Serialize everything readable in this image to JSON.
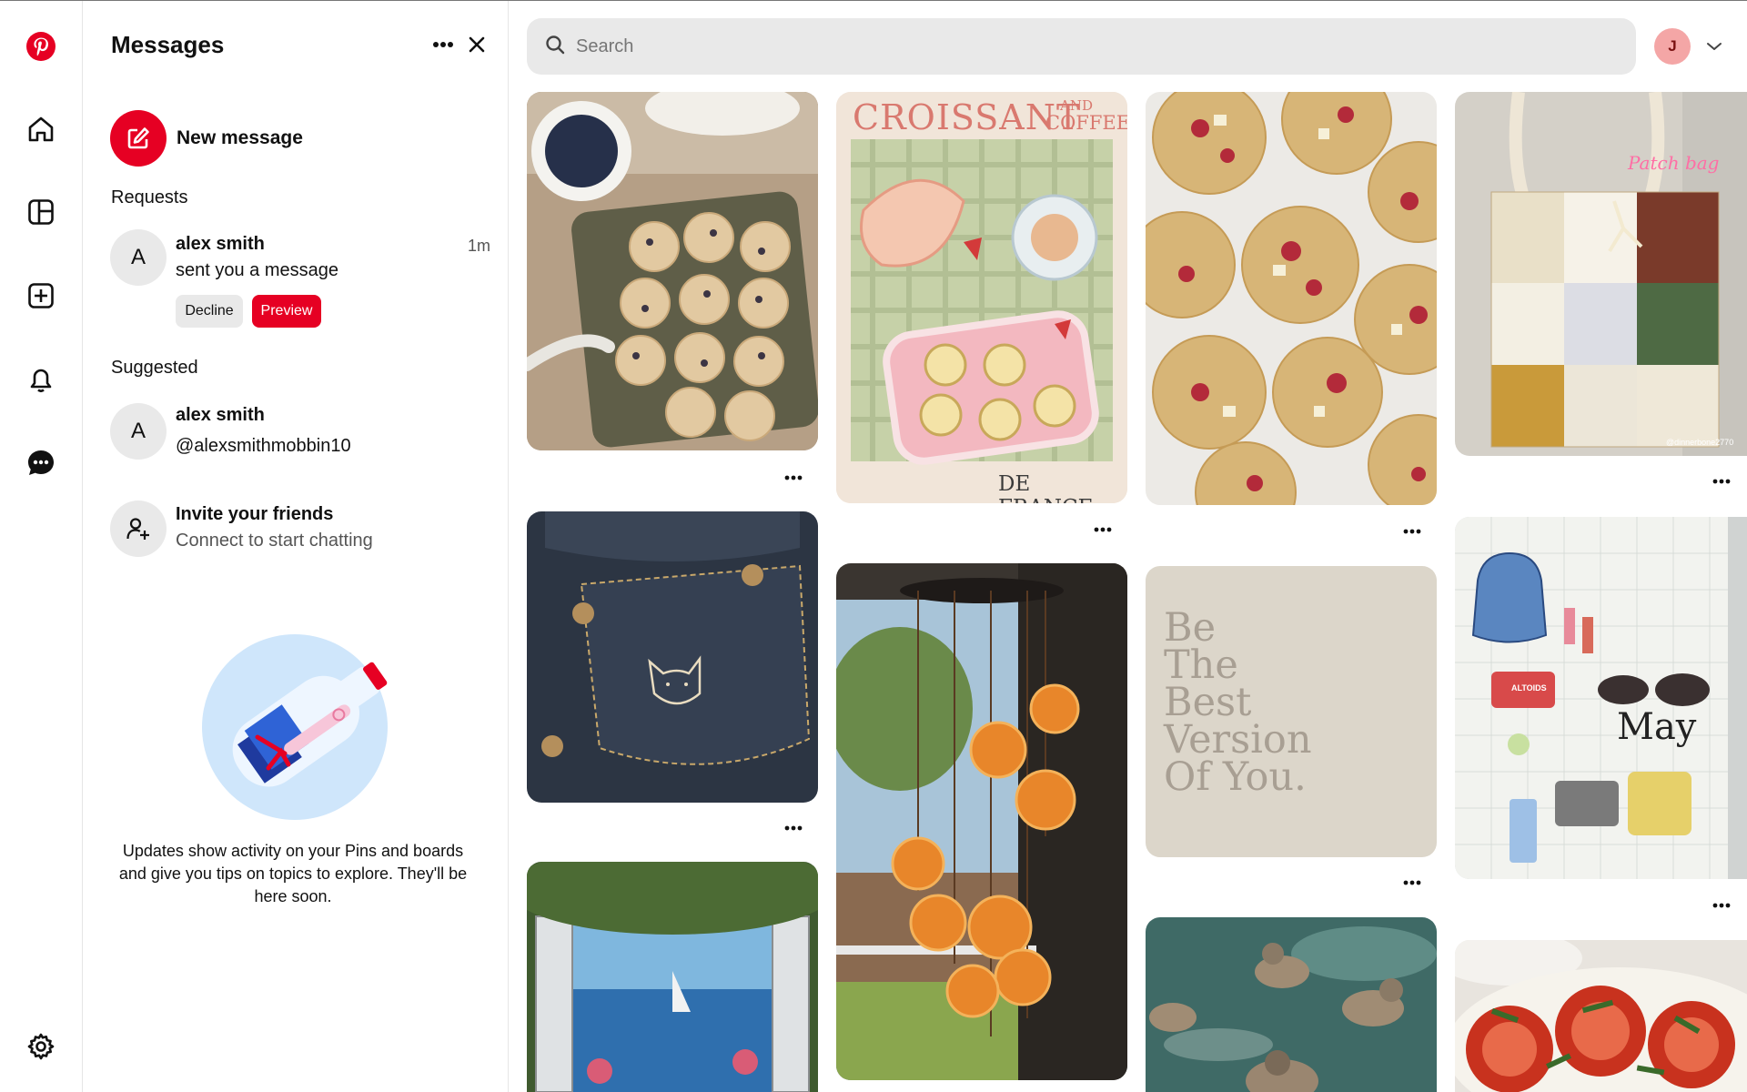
{
  "rail": {
    "items": [
      {
        "name": "pinterest-logo",
        "icon": "pinterest-logo-icon"
      },
      {
        "name": "home",
        "icon": "home-icon"
      },
      {
        "name": "boards",
        "icon": "boards-icon"
      },
      {
        "name": "create",
        "icon": "plus-icon"
      },
      {
        "name": "notifications",
        "icon": "bell-icon"
      },
      {
        "name": "messages",
        "icon": "chat-icon"
      },
      {
        "name": "settings",
        "icon": "gear-icon"
      }
    ],
    "brand_color": "#e60023"
  },
  "messages_panel": {
    "title": "Messages",
    "new_message_label": "New message",
    "requests_label": "Requests",
    "request": {
      "avatar_letter": "A",
      "name": "alex smith",
      "text": "sent you a message",
      "time": "1m",
      "decline_label": "Decline",
      "preview_label": "Preview"
    },
    "suggested_label": "Suggested",
    "suggested": {
      "avatar_letter": "A",
      "name": "alex smith",
      "handle": "@alexsmithmobbin10"
    },
    "invite": {
      "title": "Invite your friends",
      "subtitle": "Connect to start chatting"
    },
    "info_text": "Updates show activity on your Pins and boards and give you tips on topics to explore. They'll be here soon."
  },
  "search": {
    "placeholder": "Search"
  },
  "user": {
    "avatar_letter": "J"
  },
  "pins": [
    {
      "name": "blueberry-muffins-pin"
    },
    {
      "name": "croissant-coffee-poster-pin",
      "title_text": "CROISSANT",
      "and_text": "AND",
      "coffee_text": "COFFEE",
      "footer_text": "DE FRANCE"
    },
    {
      "name": "raspberry-cookies-pin"
    },
    {
      "name": "patchwork-bag-pin",
      "overlay_text": "Patch bag",
      "credit_text": "@dinnerbone2770"
    },
    {
      "name": "denim-cat-pocket-pin"
    },
    {
      "name": "orange-suncatcher-pin"
    },
    {
      "name": "quote-pin",
      "lines": [
        "Be",
        "The",
        "Best",
        "Version",
        "Of You."
      ]
    },
    {
      "name": "may-journal-pin",
      "overlay_text": "May",
      "tin_text": "ALTOIDS"
    },
    {
      "name": "sea-window-pin"
    },
    {
      "name": "ducks-pin"
    },
    {
      "name": "tomato-salad-pin"
    }
  ]
}
